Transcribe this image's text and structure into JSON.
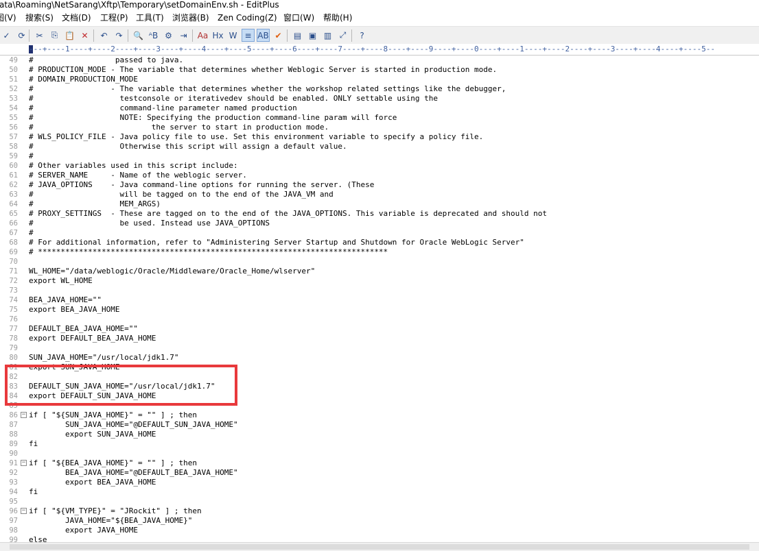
{
  "window": {
    "title": "ata\\Roaming\\NetSarang\\Xftp\\Temporary\\setDomainEnv.sh - EditPlus"
  },
  "menu": [
    "图(V)",
    "搜索(S)",
    "文档(D)",
    "工程(P)",
    "工具(T)",
    "浏览器(B)",
    "Zen Coding(Z)",
    "窗口(W)",
    "帮助(H)"
  ],
  "toolbar": [
    {
      "name": "spellcheck-icon",
      "glyph": "✓"
    },
    {
      "name": "refresh-icon",
      "glyph": "⟳"
    },
    {
      "name": "cut-icon",
      "glyph": "✂"
    },
    {
      "name": "copy-icon",
      "glyph": "⎘"
    },
    {
      "name": "paste-icon",
      "glyph": "📋"
    },
    {
      "name": "delete-icon",
      "glyph": "✕"
    },
    {
      "name": "undo-icon",
      "glyph": "↶"
    },
    {
      "name": "redo-icon",
      "glyph": "↷"
    },
    {
      "name": "find-icon",
      "glyph": "🔍"
    },
    {
      "name": "replace-icon",
      "glyph": "ᴬB"
    },
    {
      "name": "find-in-files-icon",
      "glyph": "⚙"
    },
    {
      "name": "goto-icon",
      "glyph": "⇥"
    },
    {
      "name": "font-icon",
      "glyph": "Aa"
    },
    {
      "name": "heading-icon",
      "glyph": "Hx"
    },
    {
      "name": "word-wrap-icon",
      "glyph": "W"
    },
    {
      "name": "line-number-icon",
      "glyph": "≡"
    },
    {
      "name": "ruler-icon",
      "glyph": "AB"
    },
    {
      "name": "check-icon",
      "glyph": "✔"
    },
    {
      "name": "directory-window-icon",
      "glyph": "▤"
    },
    {
      "name": "output-window-icon",
      "glyph": "▣"
    },
    {
      "name": "cliptext-icon",
      "glyph": "▥"
    },
    {
      "name": "fullscreen-icon",
      "glyph": "⤢"
    },
    {
      "name": "help-icon",
      "glyph": "?"
    }
  ],
  "ruler": "---+----1----+----2----+----3----+----4----+----5----+----6----+----7----+----8----+----9----+----0----+----1----+----2----+----3----+----4----+----5--",
  "lines": [
    {
      "n": "49",
      "t": "#                  passed to java."
    },
    {
      "n": "50",
      "t": "# PRODUCTION_MODE - The variable that determines whether Weblogic Server is started in production mode."
    },
    {
      "n": "51",
      "t": "# DOMAIN_PRODUCTION_MODE"
    },
    {
      "n": "52",
      "t": "#                 - The variable that determines whether the workshop related settings like the debugger,"
    },
    {
      "n": "53",
      "t": "#                   testconsole or iterativedev should be enabled. ONLY settable using the"
    },
    {
      "n": "54",
      "t": "#                   command-line parameter named production"
    },
    {
      "n": "55",
      "t": "#                   NOTE: Specifying the production command-line param will force"
    },
    {
      "n": "56",
      "t": "#                          the server to start in production mode."
    },
    {
      "n": "57",
      "t": "# WLS_POLICY_FILE - Java policy file to use. Set this environment variable to specify a policy file."
    },
    {
      "n": "58",
      "t": "#                   Otherwise this script will assign a default value."
    },
    {
      "n": "59",
      "t": "#"
    },
    {
      "n": "60",
      "t": "# Other variables used in this script include:"
    },
    {
      "n": "61",
      "t": "# SERVER_NAME     - Name of the weblogic server."
    },
    {
      "n": "62",
      "t": "# JAVA_OPTIONS    - Java command-line options for running the server. (These"
    },
    {
      "n": "63",
      "t": "#                   will be tagged on to the end of the JAVA_VM and"
    },
    {
      "n": "64",
      "t": "#                   MEM_ARGS)"
    },
    {
      "n": "65",
      "t": "# PROXY_SETTINGS  - These are tagged on to the end of the JAVA_OPTIONS. This variable is deprecated and should not"
    },
    {
      "n": "66",
      "t": "#                   be used. Instead use JAVA_OPTIONS"
    },
    {
      "n": "67",
      "t": "#"
    },
    {
      "n": "68",
      "t": "# For additional information, refer to \"Administering Server Startup and Shutdown for Oracle WebLogic Server\""
    },
    {
      "n": "69",
      "t": "# *****************************************************************************"
    },
    {
      "n": "70",
      "t": ""
    },
    {
      "n": "71",
      "t": "WL_HOME=\"/data/weblogic/Oracle/Middleware/Oracle_Home/wlserver\""
    },
    {
      "n": "72",
      "t": "export WL_HOME"
    },
    {
      "n": "73",
      "t": ""
    },
    {
      "n": "74",
      "t": "BEA_JAVA_HOME=\"\""
    },
    {
      "n": "75",
      "t": "export BEA_JAVA_HOME"
    },
    {
      "n": "76",
      "t": ""
    },
    {
      "n": "77",
      "t": "DEFAULT_BEA_JAVA_HOME=\"\""
    },
    {
      "n": "78",
      "t": "export DEFAULT_BEA_JAVA_HOME"
    },
    {
      "n": "79",
      "t": ""
    },
    {
      "n": "80",
      "t": "SUN_JAVA_HOME=\"/usr/local/jdk1.7\""
    },
    {
      "n": "81",
      "t": "export SUN_JAVA_HOME"
    },
    {
      "n": "82",
      "t": ""
    },
    {
      "n": "83",
      "t": "DEFAULT_SUN_JAVA_HOME=\"/usr/local/jdk1.7\""
    },
    {
      "n": "84",
      "t": "export DEFAULT_SUN_JAVA_HOME"
    },
    {
      "n": "85",
      "t": ""
    },
    {
      "n": "86",
      "t": "if [ \"${SUN_JAVA_HOME}\" = \"\" ] ; then",
      "fold": true
    },
    {
      "n": "87",
      "t": "        SUN_JAVA_HOME=\"@DEFAULT_SUN_JAVA_HOME\""
    },
    {
      "n": "88",
      "t": "        export SUN_JAVA_HOME"
    },
    {
      "n": "89",
      "t": "fi"
    },
    {
      "n": "90",
      "t": ""
    },
    {
      "n": "91",
      "t": "if [ \"${BEA_JAVA_HOME}\" = \"\" ] ; then",
      "fold": true
    },
    {
      "n": "92",
      "t": "        BEA_JAVA_HOME=\"@DEFAULT_BEA_JAVA_HOME\""
    },
    {
      "n": "93",
      "t": "        export BEA_JAVA_HOME"
    },
    {
      "n": "94",
      "t": "fi"
    },
    {
      "n": "95",
      "t": ""
    },
    {
      "n": "96",
      "t": "if [ \"${VM_TYPE}\" = \"JRockit\" ] ; then",
      "fold": true
    },
    {
      "n": "97",
      "t": "        JAVA_HOME=\"${BEA_JAVA_HOME}\""
    },
    {
      "n": "98",
      "t": "        export JAVA_HOME"
    },
    {
      "n": "99",
      "t": "else"
    }
  ],
  "colors": {
    "annotation": "#e8393c",
    "ruler_text": "#4060a0",
    "line_number": "#9a9a9a"
  }
}
